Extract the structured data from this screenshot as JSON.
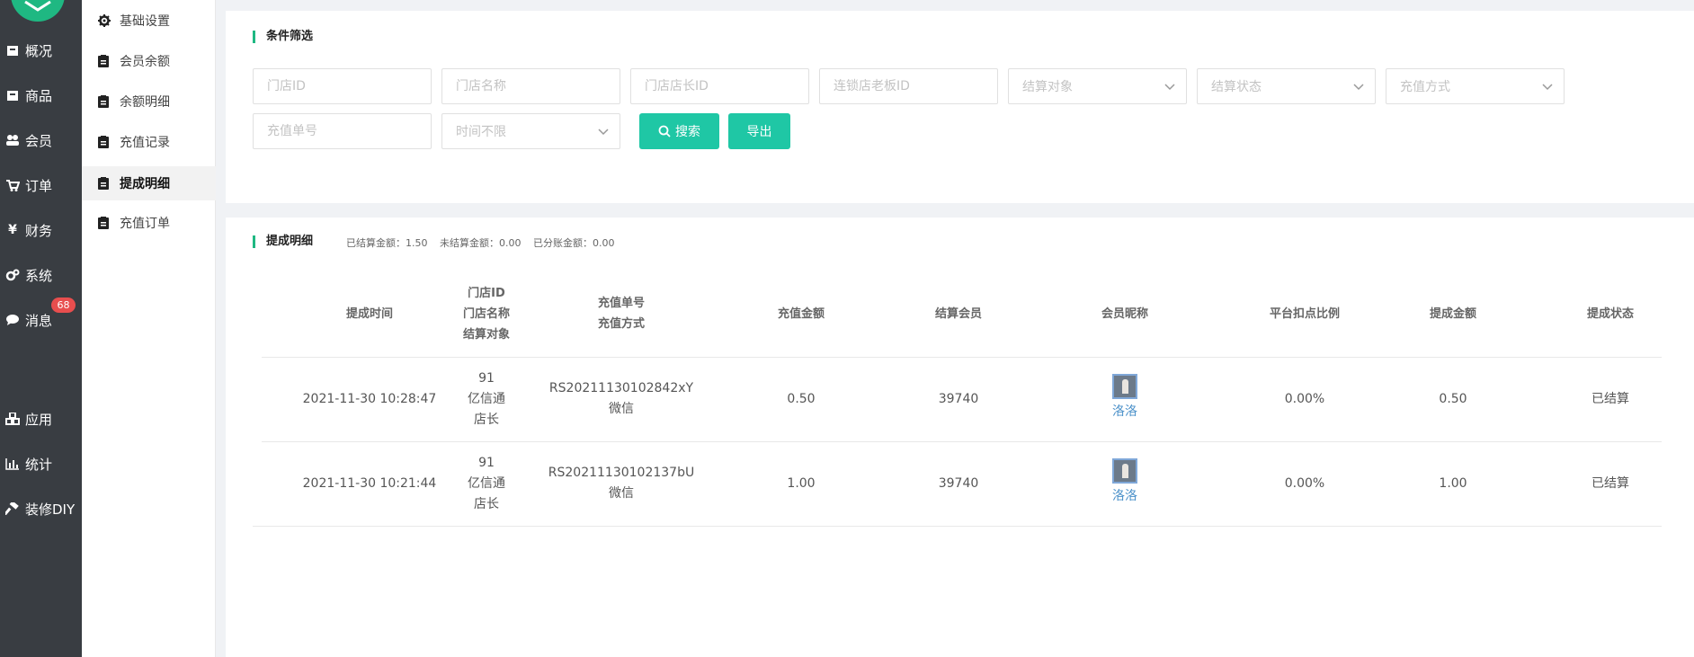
{
  "nav": {
    "items": [
      {
        "label": "概况",
        "icon": "box-icon"
      },
      {
        "label": "商品",
        "icon": "box-icon"
      },
      {
        "label": "会员",
        "icon": "users-icon"
      },
      {
        "label": "订单",
        "icon": "cart-icon"
      },
      {
        "label": "财务",
        "icon": "yen-icon"
      },
      {
        "label": "系统",
        "icon": "gears-icon"
      },
      {
        "label": "消息",
        "icon": "comment-icon"
      },
      {
        "label": "应用",
        "icon": "cubes-icon"
      },
      {
        "label": "统计",
        "icon": "bar-chart-icon"
      },
      {
        "label": "装修DIY",
        "icon": "hammer-icon"
      }
    ],
    "message_badge": "68",
    "accent": "#1fb882"
  },
  "subnav": {
    "items": [
      {
        "label": "基础设置",
        "icon": "gear-icon"
      },
      {
        "label": "会员余额",
        "icon": "clipboard-icon"
      },
      {
        "label": "余额明细",
        "icon": "clipboard-icon"
      },
      {
        "label": "充值记录",
        "icon": "clipboard-icon"
      },
      {
        "label": "提成明细",
        "icon": "clipboard-icon",
        "active": true
      },
      {
        "label": "充值订单",
        "icon": "clipboard-icon"
      }
    ]
  },
  "filter": {
    "title": "条件筛选",
    "store_id_placeholder": "门店ID",
    "store_name_placeholder": "门店名称",
    "store_manager_id_placeholder": "门店店长ID",
    "chain_owner_id_placeholder": "连锁店老板ID",
    "settle_target_placeholder": "结算对象",
    "settle_status_placeholder": "结算状态",
    "recharge_method_placeholder": "充值方式",
    "recharge_no_placeholder": "充值单号",
    "time_placeholder": "时间不限",
    "search_label": "搜索",
    "export_label": "导出",
    "button_color": "#1fc7a5"
  },
  "list": {
    "title": "提成明细",
    "settled_amount": "已结算金额：1.50",
    "unsettled_amount": "未结算金额：0.00",
    "split_amount": "已分账金额：0.00",
    "headers": {
      "time": "提成时间",
      "store_id": "门店ID",
      "store_name": "门店名称",
      "settle_target": "结算对象",
      "recharge_no": "充值单号",
      "recharge_method": "充值方式",
      "recharge_amount": "充值金额",
      "settle_member": "结算会员",
      "member_nick": "会员昵称",
      "platform_ratio": "平台扣点比例",
      "commission": "提成金额",
      "status": "提成状态"
    },
    "rows": [
      {
        "time": "2021-11-30 10:28:47",
        "store_id": "91",
        "store_name": "亿信通",
        "settle_target": "店长",
        "recharge_no": "RS20211130102842xY",
        "recharge_method": "微信",
        "recharge_amount": "0.50",
        "settle_member": "39740",
        "nick": "洛洛",
        "ratio": "0.00%",
        "commission": "0.50",
        "status": "已结算"
      },
      {
        "time": "2021-11-30 10:21:44",
        "store_id": "91",
        "store_name": "亿信通",
        "settle_target": "店长",
        "recharge_no": "RS20211130102137bU",
        "recharge_method": "微信",
        "recharge_amount": "1.00",
        "settle_member": "39740",
        "nick": "洛洛",
        "ratio": "0.00%",
        "commission": "1.00",
        "status": "已结算"
      }
    ]
  }
}
